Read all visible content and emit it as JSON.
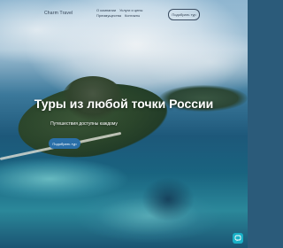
{
  "header": {
    "logo": "Charm Travel",
    "menu": [
      "О компании",
      "Услуги и цены",
      "Преимущества",
      "Контакты"
    ],
    "cta_label": "Подобрать тур"
  },
  "hero": {
    "title": "Туры из любой точки России",
    "subtitle": "Путешествия доступны каждому",
    "cta_label": "Подобрать тур"
  },
  "chat_widget": {
    "icon": "chat-icon",
    "color": "#19b0c6"
  },
  "colors": {
    "accent": "#2a6fa8",
    "nav_text": "#2f3f52"
  }
}
